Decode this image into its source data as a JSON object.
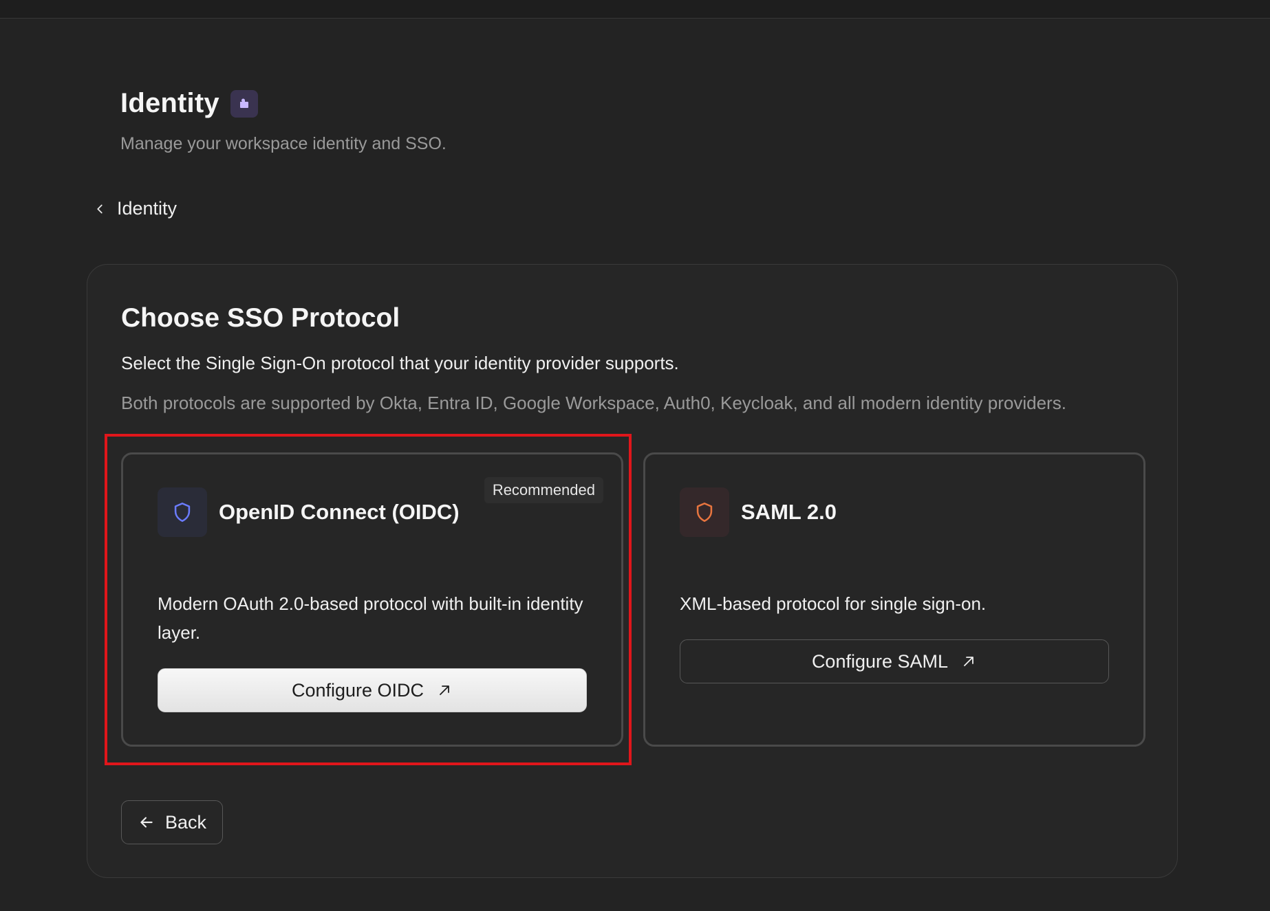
{
  "header": {
    "title": "Identity",
    "subtitle": "Manage your workspace identity and SSO.",
    "badge_icon": "puzzle-icon"
  },
  "breadcrumb": {
    "label": "Identity",
    "icon": "chevron-left-icon"
  },
  "panel": {
    "title": "Choose SSO Protocol",
    "description": "Select the Single Sign-On protocol that your identity provider supports.",
    "note": "Both protocols are supported by Okta, Entra ID, Google Workspace, Auth0, Keycloak, and all modern identity providers."
  },
  "cards": {
    "oidc": {
      "title": "OpenID Connect (OIDC)",
      "badge": "Recommended",
      "description": "Modern OAuth 2.0-based protocol with built-in identity layer.",
      "button": "Configure OIDC",
      "icon": "shield-icon",
      "icon_color": "#6b7cff"
    },
    "saml": {
      "title": "SAML 2.0",
      "description": "XML-based protocol for single sign-on.",
      "button": "Configure SAML",
      "icon": "shield-icon",
      "icon_color": "#e8753f"
    }
  },
  "footer": {
    "back_label": "Back",
    "back_icon": "arrow-left-icon"
  },
  "colors": {
    "background": "#232323",
    "highlight": "#e0161b"
  }
}
